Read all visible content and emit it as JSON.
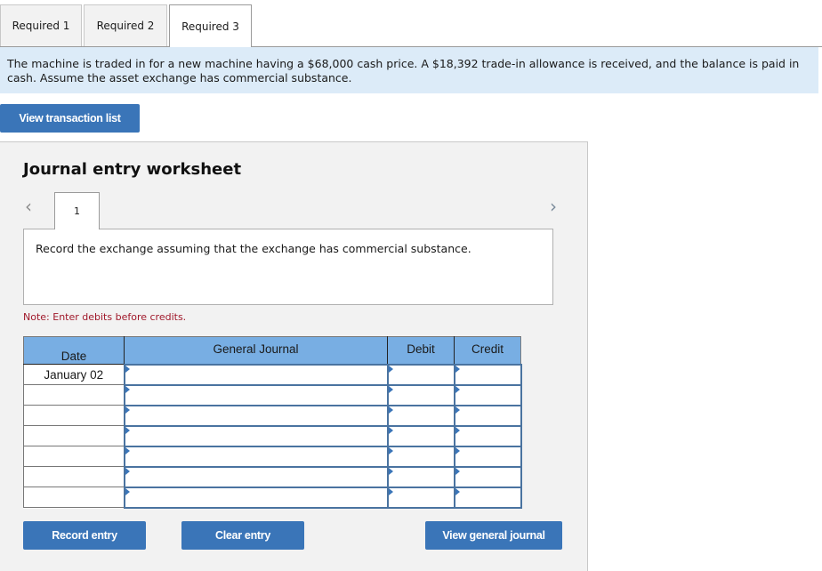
{
  "tabs": [
    {
      "label": "Required 1",
      "active": false
    },
    {
      "label": "Required 2",
      "active": false
    },
    {
      "label": "Required 3",
      "active": true
    }
  ],
  "prompt": {
    "text": "The machine is traded in for a new machine having a $68,000 cash price. A $18,392 trade-in allowance is received, and the balance is paid in cash. Assume the asset exchange has commercial substance."
  },
  "buttons": {
    "view_transaction_list": "View transaction list",
    "record_entry": "Record entry",
    "clear_entry": "Clear entry",
    "view_general_journal": "View general journal"
  },
  "worksheet": {
    "title": "Journal entry worksheet",
    "nav_prev_icon": "‹",
    "nav_next_icon": "›",
    "current_step": "1",
    "instruction": "Record the exchange assuming that the exchange has commercial substance.",
    "note": "Note: Enter debits before credits."
  },
  "journal": {
    "headers": {
      "date": "Date",
      "general_journal": "General Journal",
      "debit": "Debit",
      "credit": "Credit"
    },
    "rows": [
      {
        "date": "January 02",
        "account": "",
        "debit": "",
        "credit": ""
      },
      {
        "date": "",
        "account": "",
        "debit": "",
        "credit": ""
      },
      {
        "date": "",
        "account": "",
        "debit": "",
        "credit": ""
      },
      {
        "date": "",
        "account": "",
        "debit": "",
        "credit": ""
      },
      {
        "date": "",
        "account": "",
        "debit": "",
        "credit": ""
      },
      {
        "date": "",
        "account": "",
        "debit": "",
        "credit": ""
      },
      {
        "date": "",
        "account": "",
        "debit": "",
        "credit": ""
      }
    ]
  },
  "colors": {
    "accent_button": "#3a75b8",
    "prompt_background": "#dcebf8",
    "table_header": "#78aee3",
    "note_text": "#a0182a",
    "panel_background": "#f2f2f2"
  }
}
